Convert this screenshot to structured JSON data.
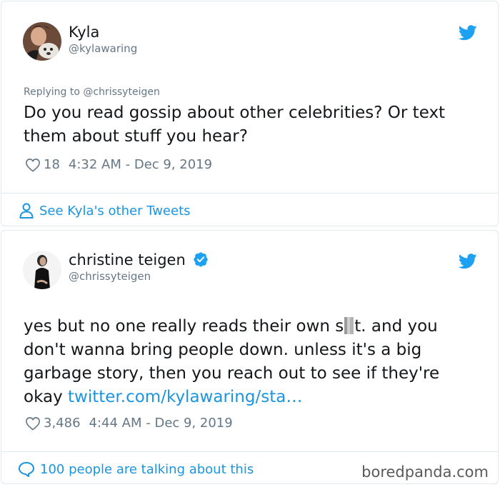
{
  "tweet1": {
    "name": "Kyla",
    "handle": "@kylawaring",
    "replying_to": "Replying to @chrissyteigen",
    "text_line1": "Do you read gossip about other celebrities? Or text",
    "text_line2": "them about stuff you hear?",
    "likes": "18",
    "timestamp": "4:32 AM - Dec 9, 2019",
    "footer_link": "See Kyla's other Tweets"
  },
  "tweet2": {
    "name": "christine teigen",
    "handle": "@chrissyteigen",
    "text_line1_a": "yes but no one really reads their own s",
    "text_line1_b": "t. and you",
    "text_line2": "don't wanna bring people down. unless it's a big",
    "text_line3": "garbage story, then you reach out to see if they're",
    "text_line4_a": "okay ",
    "link": "twitter.com/kylawaring/sta…",
    "likes": "3,486",
    "timestamp": "4:44 AM - Dec 9, 2019",
    "footer_link": "100 people are talking about this"
  },
  "watermark": "boredpanda.com",
  "colors": {
    "link": "#1b95e0",
    "verified": "#1da1f2",
    "secondary_text": "#657786",
    "border": "#e1e8ed"
  }
}
